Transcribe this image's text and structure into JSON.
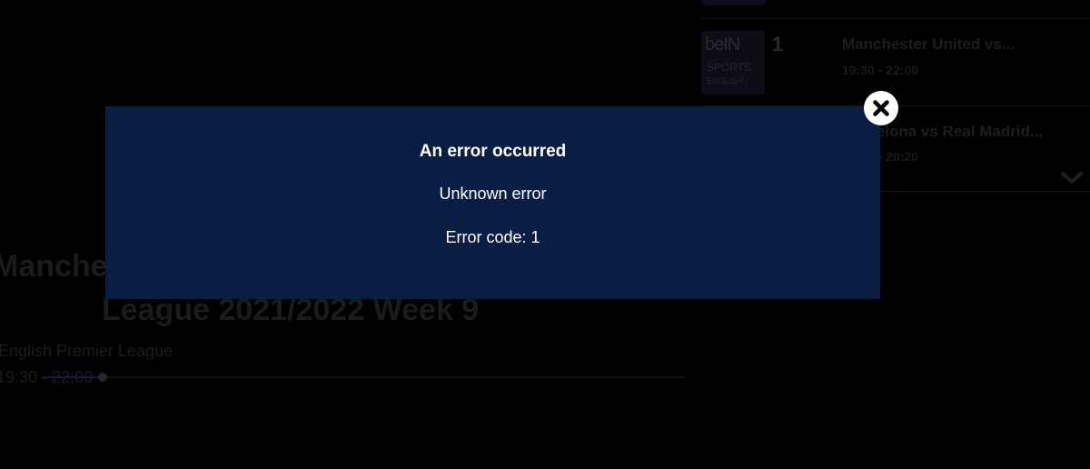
{
  "program": {
    "title": "Manchester United vs Liverpool Premier",
    "subtitle": "League 2021/2022 Week 9",
    "league": "English Premier League",
    "time": "19:30 - 22:00",
    "progress_percent": 9.5
  },
  "channel_list": {
    "channel": {
      "brand": "beIN",
      "sports": "SPORTS",
      "language": "ENGLISH",
      "number": "1"
    },
    "items": [
      {
        "title": "Manchester United vs...",
        "time": "19:30 - 22:00"
      },
      {
        "title": "Barcelona vs Real Madrid...",
        "time": "19:30 - 20:20"
      }
    ]
  },
  "modal": {
    "title": "An error occurred",
    "message": "Unknown error",
    "code_text": "Error code: 1"
  },
  "icons": {
    "close": "close-icon",
    "chevron": "chevron-down-icon"
  },
  "colors": {
    "modal_background": "#0a1e44",
    "page_background": "#000000",
    "text": "#ffffff"
  }
}
